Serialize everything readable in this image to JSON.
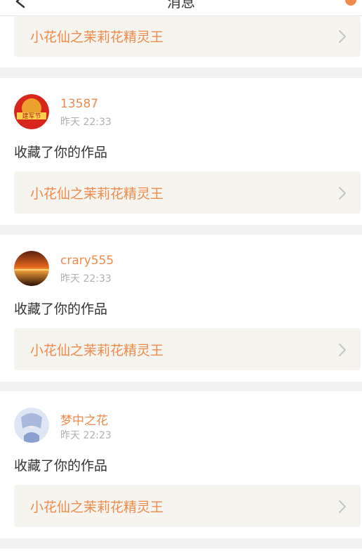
{
  "nav": {
    "title": "消息",
    "back_icon": "back-icon"
  },
  "items": [
    {
      "work_title": "小花仙之茉莉花精灵王"
    },
    {
      "username": "13587",
      "time": "昨天 22:33",
      "action": "收藏了你的作品",
      "work_title": "小花仙之茉莉花精灵王",
      "avatar_icon": "avatar"
    },
    {
      "username": "crary555",
      "time": "昨天 22:33",
      "action": "收藏了你的作品",
      "work_title": "小花仙之茉莉花精灵王",
      "avatar_icon": "avatar"
    },
    {
      "username": "梦中之花",
      "time": "昨天 22:23",
      "action": "收藏了你的作品",
      "work_title": "小花仙之茉莉花精灵王",
      "avatar_icon": "avatar"
    }
  ],
  "colors": {
    "accent": "#f08a4b",
    "text": "#333333",
    "muted": "#b0b0b0",
    "link_bg": "#f5f4ef",
    "page_bg": "#f2f2f2"
  }
}
